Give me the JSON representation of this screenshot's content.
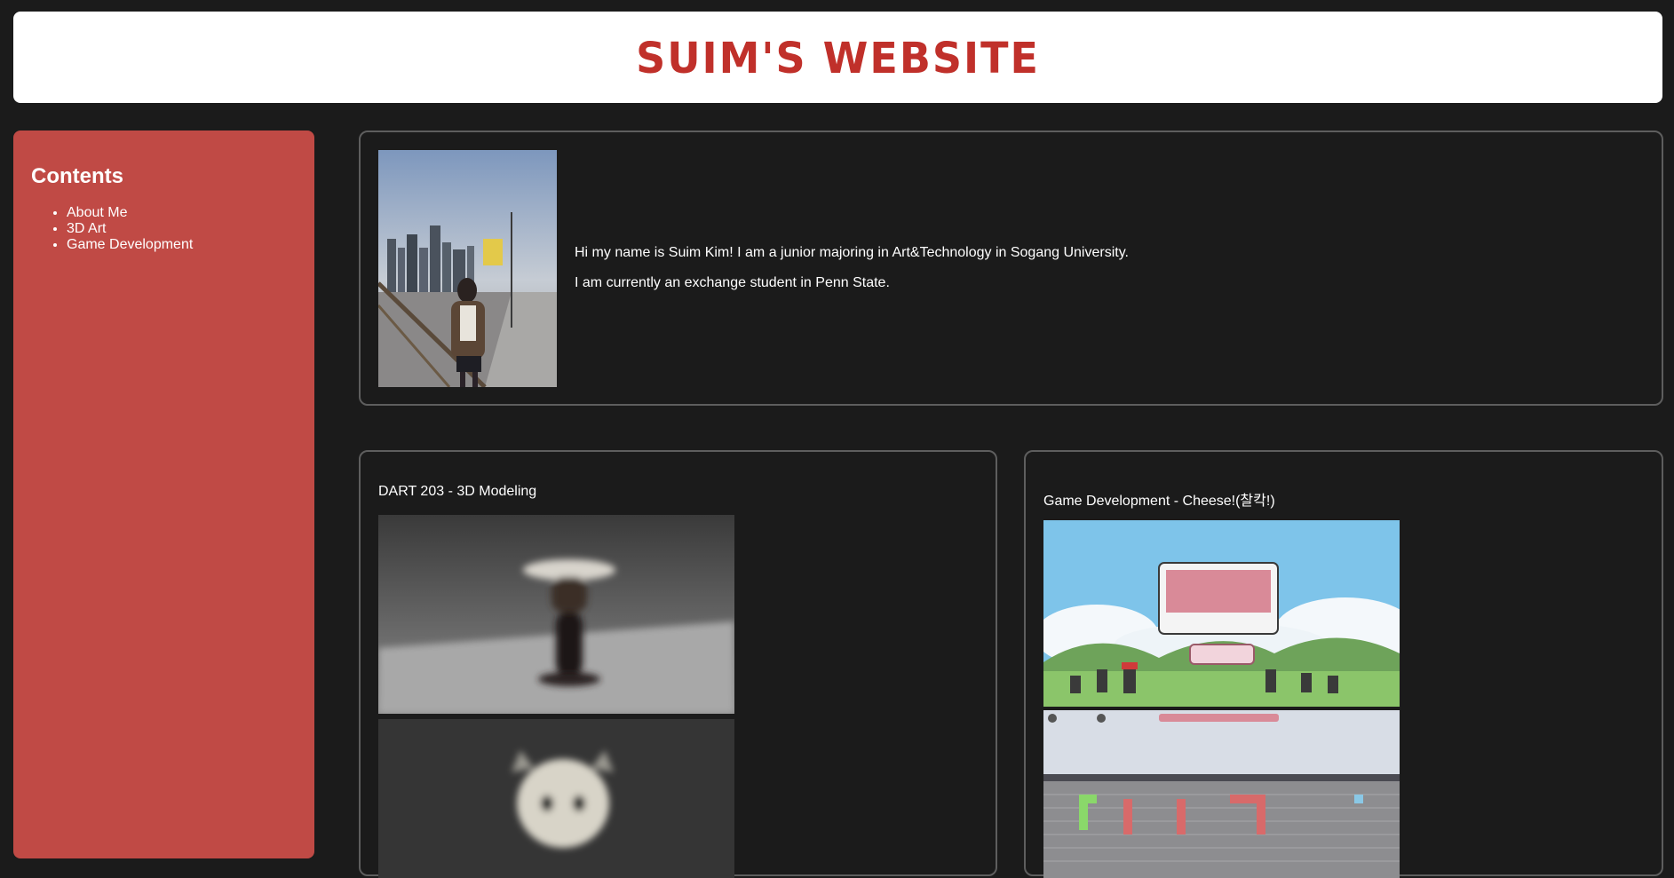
{
  "header": {
    "title": "Suim's Website"
  },
  "sidebar": {
    "heading": "Contents",
    "items": [
      {
        "label": "About Me"
      },
      {
        "label": "3D Art"
      },
      {
        "label": "Game Development"
      }
    ]
  },
  "about": {
    "line1": "Hi my name is Suim Kim! I am a junior majoring in Art&Technology in Sogang University.",
    "line2": "I am currently an exchange student in Penn State."
  },
  "art": {
    "title": "DART 203 - 3D Modeling"
  },
  "game": {
    "title": "Game Development - Cheese!(찰칵!)"
  },
  "colors": {
    "accent": "#c0302a",
    "sidebar": "#c04a45",
    "background": "#1b1b1b"
  }
}
